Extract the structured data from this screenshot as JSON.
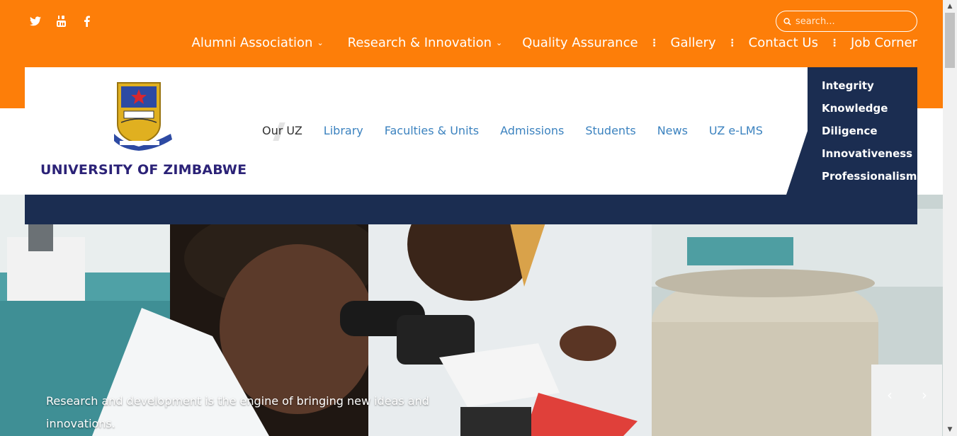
{
  "social": {
    "icons": [
      "twitter-icon",
      "youtube-icon",
      "facebook-icon"
    ]
  },
  "search": {
    "placeholder": "search..."
  },
  "topnav": {
    "alumni": "Alumni Association",
    "research": "Research & Innovation",
    "quality": "Quality Assurance",
    "gallery": "Gallery",
    "contact": "Contact Us",
    "jobs": "Job Corner"
  },
  "logo": {
    "text": "UNIVERSITY OF ZIMBABWE"
  },
  "mainnav": {
    "our_uz": "Our UZ",
    "library": "Library",
    "faculties": "Faculties & Units",
    "admissions": "Admissions",
    "students": "Students",
    "news": "News",
    "elms": "UZ e-LMS"
  },
  "values": {
    "items": [
      "Integrity",
      "Knowledge",
      "Diligence",
      "Innovativeness",
      "Professionalism"
    ]
  },
  "hero": {
    "caption": "Research and development is the engine of bringing new ideas and innovations."
  },
  "colors": {
    "orange": "#fd7e09",
    "navy": "#1b2d51",
    "link_blue": "#3b82bf",
    "logo_purple": "#2b2277"
  }
}
